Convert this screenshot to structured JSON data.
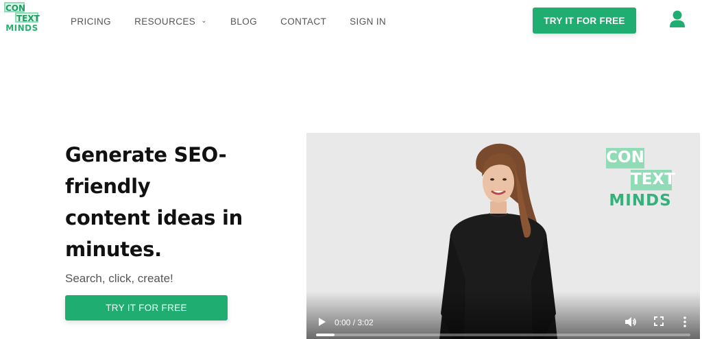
{
  "brand": {
    "logo_line1": "CON",
    "logo_line2": "TEXT",
    "logo_line3": "MINDS",
    "accent": "#1fad72",
    "logo_light": "#8fdcb6"
  },
  "nav": {
    "items": [
      {
        "label": "PRICING"
      },
      {
        "label": "RESOURCES",
        "icon": "chevron-down-icon"
      },
      {
        "label": "BLOG"
      },
      {
        "label": "CONTACT"
      },
      {
        "label": "SIGN IN"
      }
    ],
    "cta_label": "TRY IT FOR FREE",
    "user_icon": "user-icon"
  },
  "hero": {
    "title_lines": [
      "Generate SEO-",
      "friendly",
      "content ideas in",
      "minutes."
    ],
    "subtitle": "Search, click, create!",
    "cta_label": "TRY IT FOR FREE"
  },
  "video": {
    "time_display": "0:00 / 3:02",
    "progress_fraction": 0.05,
    "overlay_logo": [
      "CON",
      "TEXT",
      "MINDS"
    ],
    "controls": [
      "play-icon",
      "volume-icon",
      "fullscreen-icon",
      "more-icon"
    ]
  }
}
